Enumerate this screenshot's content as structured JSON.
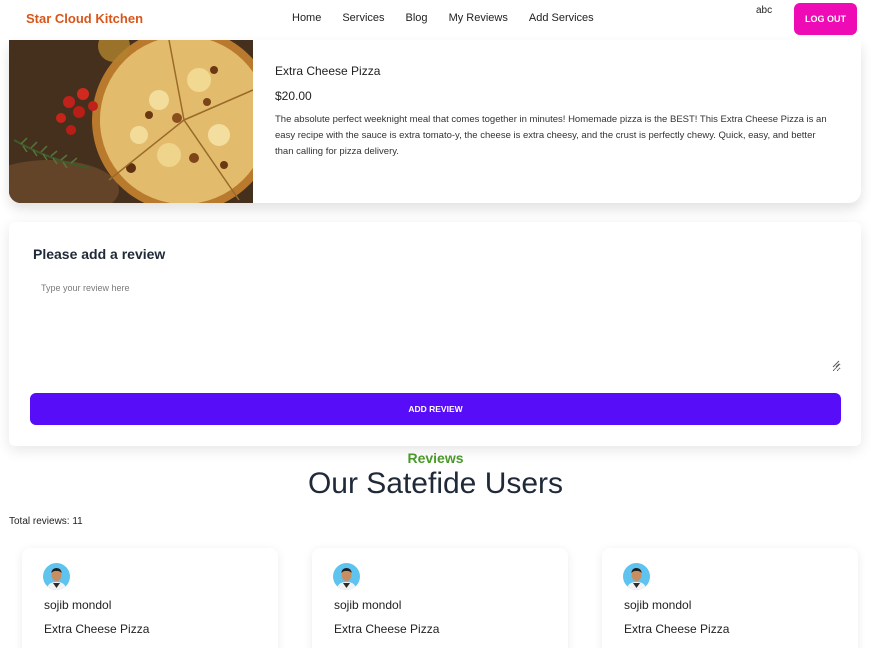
{
  "navbar": {
    "brand": "Star Cloud Kitchen",
    "links": [
      "Home",
      "Services",
      "Blog",
      "My Reviews",
      "Add Services"
    ],
    "user_name": "abc",
    "logout_label": "LOG OUT"
  },
  "service": {
    "title": "Extra Cheese Pizza",
    "price": "$20.00",
    "description": "The absolute perfect weeknight meal that comes together in minutes! Homemade pizza is the BEST! This Extra Cheese Pizza is an easy recipe with the sauce is extra tomato-y, the cheese is extra cheesy, and the crust is perfectly chewy. Quick, easy, and better than calling for pizza delivery."
  },
  "review_form": {
    "heading": "Please add a review",
    "placeholder": "Type your review here",
    "value": "",
    "submit_label": "ADD REVIEW"
  },
  "reviews_section": {
    "kicker": "Reviews",
    "title": "Our Satefide Users",
    "total": "Total reviews: 11",
    "items": [
      {
        "name": "sojib mondol",
        "service": "Extra Cheese Pizza"
      },
      {
        "name": "sojib mondol",
        "service": "Extra Cheese Pizza"
      },
      {
        "name": "sojib mondol",
        "service": "Extra Cheese Pizza"
      }
    ]
  },
  "colors": {
    "brand": "#d9561a",
    "logout": "#ee0ab4",
    "primary_button": "#570df8",
    "kicker": "#4a9a2a"
  }
}
